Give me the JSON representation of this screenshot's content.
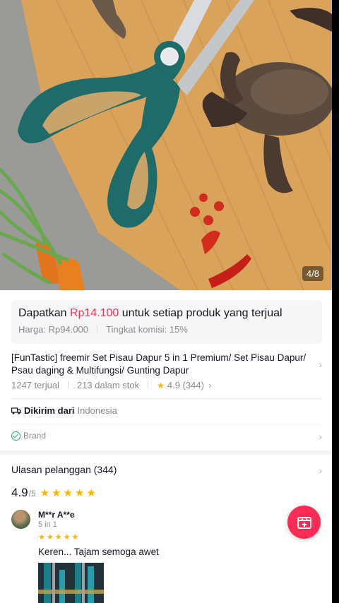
{
  "hero": {
    "image_alt": "Gunting dapur hijau di atas talenan dengan kepiting, cabai dan wortel",
    "page_indicator": "4/8"
  },
  "commission": {
    "prefix": "Dapatkan ",
    "amount": "Rp14.100",
    "suffix": " untuk setiap produk yang terjual",
    "price": "Harga: Rp94.000",
    "rate": "Tingkat komisi: 15%"
  },
  "product": {
    "title": "[FunTastic] freemir Set Pisau Dapur 5 in 1 Premium/ Set Pisau Dapur/ Psau daging & Multifungsi/ Gunting Dapur",
    "sold": "1247 terjual",
    "stock": "213 dalam stok",
    "rating": "4.9 (344)"
  },
  "shipping": {
    "label": "Dikirim dari",
    "origin": "Indonesia"
  },
  "brand": {
    "label": "Brand"
  },
  "reviews": {
    "header": "Ulasan pelanggan (344)",
    "score": "4.9",
    "out_of": "/5",
    "items": [
      {
        "name": "M**r A**e",
        "variant": "5 in 1",
        "text": "Keren... Tajam semoga awet"
      }
    ]
  },
  "colors": {
    "accent": "#fe2c55",
    "star": "#f5b800",
    "muted": "#8a8b91"
  },
  "icons": {
    "truck": "truck-icon",
    "check": "check-circle-icon",
    "chevron": "chevron-right-icon",
    "fab": "video-add-icon"
  }
}
